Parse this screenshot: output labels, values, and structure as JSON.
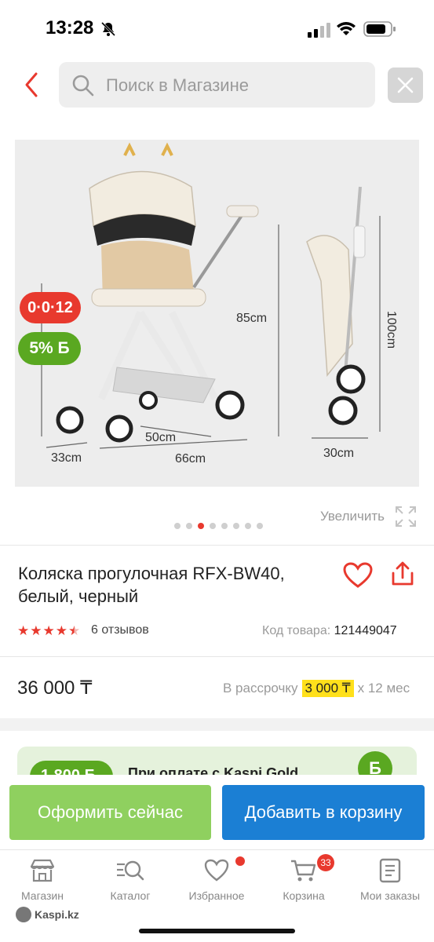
{
  "status_bar": {
    "time": "13:28"
  },
  "search": {
    "placeholder": "Поиск в Магазине"
  },
  "product_image": {
    "badges": {
      "installment": "0·0·12",
      "bonus": "5% Б"
    },
    "dimensions": {
      "height_open": "85cm",
      "height_folded": "100cm",
      "depth": "33cm",
      "width_wheels": "50cm",
      "length": "66cm",
      "width_folded": "30cm"
    }
  },
  "carousel": {
    "zoom_label": "Увеличить",
    "dot_count": 8,
    "active_index": 2
  },
  "product": {
    "title": "Коляска прогулочная RFX-BW40, белый, черный",
    "rating": 4.5,
    "reviews": "6 отзывов",
    "sku_label": "Код товара:",
    "sku_value": "121449047",
    "price": "36 000 ₸",
    "installment_prefix": "В рассрочку",
    "installment_amount": "3 000 ₸",
    "installment_suffix": "x 12 мес"
  },
  "promo": {
    "bonus": "1 800 Б",
    "text": "При оплате с Kaspi Gold",
    "coin": "Б"
  },
  "actions": {
    "checkout": "Оформить сейчас",
    "add_to_cart": "Добавить в корзину"
  },
  "tabs": [
    {
      "label": "Магазин",
      "icon": "store-icon"
    },
    {
      "label": "Каталог",
      "icon": "catalog-search-icon"
    },
    {
      "label": "Избранное",
      "icon": "heart-icon"
    },
    {
      "label": "Корзина",
      "icon": "cart-icon",
      "badge": "33"
    },
    {
      "label": "Мои заказы",
      "icon": "orders-icon"
    }
  ],
  "brand": "Kaspi.kz",
  "colors": {
    "accent_red": "#e8392e",
    "green": "#5aa821",
    "blue": "#1b7fd4",
    "light_green": "#8fd05f",
    "yellow": "#ffe01b"
  }
}
